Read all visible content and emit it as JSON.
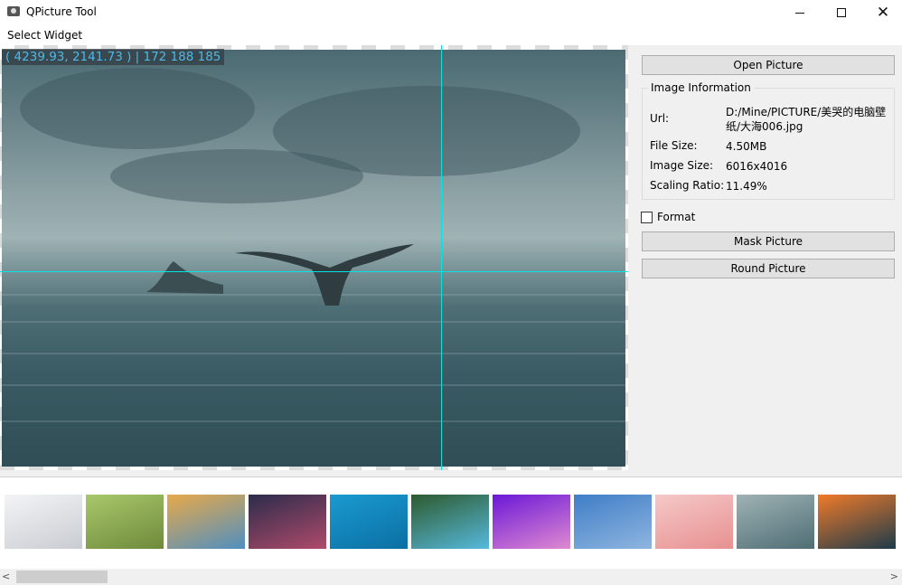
{
  "window": {
    "title": "QPicture Tool",
    "minimize_glyph": "",
    "maximize_glyph": "",
    "close_glyph": "✕"
  },
  "menu": {
    "items": [
      "Select Widget"
    ]
  },
  "viewer": {
    "readout": "( 4239.93, 2141.73 ) | 172 188 185",
    "crosshair_color": "#00e5e5"
  },
  "panel": {
    "open_label": "Open Picture",
    "group_title": "Image Information",
    "info": [
      {
        "label": "Url:",
        "value": "D:/Mine/PICTURE/美哭的电脑壁纸/大海006.jpg"
      },
      {
        "label": "File Size:",
        "value": "4.50MB"
      },
      {
        "label": "Image Size:",
        "value": "6016x4016"
      },
      {
        "label": "Scaling Ratio:",
        "value": "11.49%"
      }
    ],
    "format_label": "Format",
    "format_checked": false,
    "mask_label": "Mask Picture",
    "round_label": "Round Picture"
  },
  "thumbnails": [
    {
      "name": "snow-field",
      "colors": [
        "#f4f4f6",
        "#c8ccd2"
      ]
    },
    {
      "name": "avocado",
      "colors": [
        "#a9c86a",
        "#6e8a3c"
      ]
    },
    {
      "name": "pattern",
      "colors": [
        "#e8a94a",
        "#4f8fc0"
      ]
    },
    {
      "name": "dusk-silhouette",
      "colors": [
        "#2c2c4c",
        "#b04a6a"
      ]
    },
    {
      "name": "boat-ocean",
      "colors": [
        "#1a9ad0",
        "#0b6fa3"
      ]
    },
    {
      "name": "coastline",
      "colors": [
        "#2d5a2e",
        "#56b9dc"
      ]
    },
    {
      "name": "jellyfish",
      "colors": [
        "#6a18d8",
        "#e08ad0"
      ]
    },
    {
      "name": "swimmer",
      "colors": [
        "#3f7ec7",
        "#8fb5df"
      ]
    },
    {
      "name": "pink-chair",
      "colors": [
        "#f5c8c8",
        "#e89090"
      ]
    },
    {
      "name": "whale-tail",
      "colors": [
        "#9fb2b4",
        "#4e6e75"
      ]
    },
    {
      "name": "sunset",
      "colors": [
        "#f07a2a",
        "#1d3b4a"
      ]
    }
  ],
  "scrollbar": {
    "left_arrow": "<",
    "right_arrow": ">"
  }
}
